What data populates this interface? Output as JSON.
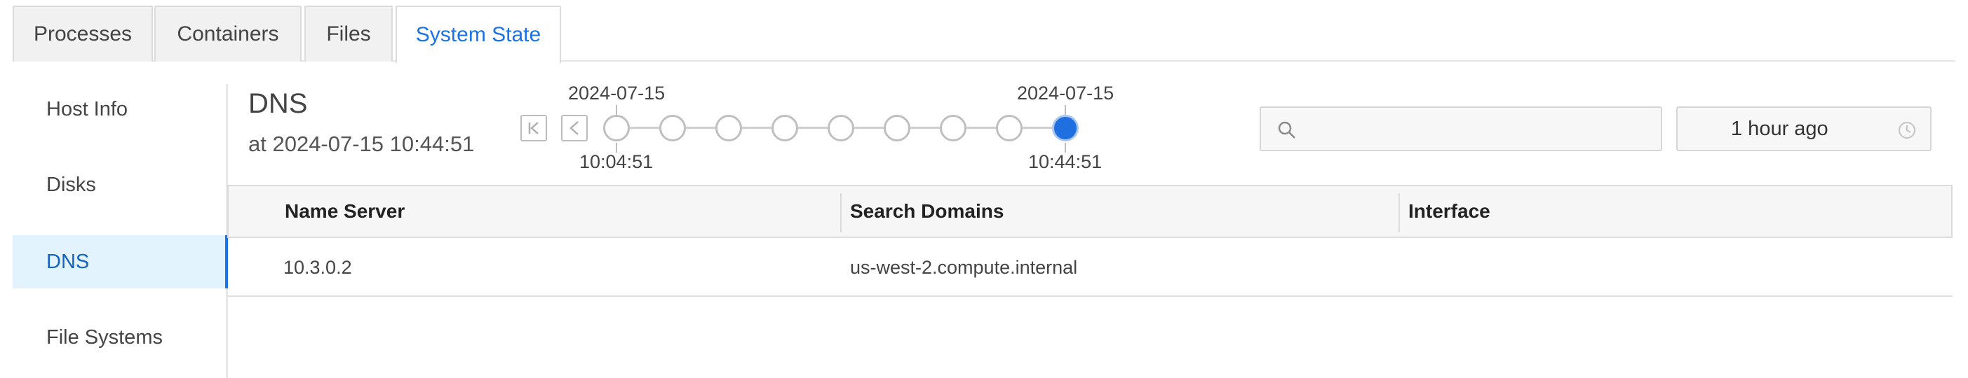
{
  "tabs": [
    {
      "label": "Processes",
      "active": false
    },
    {
      "label": "Containers",
      "active": false
    },
    {
      "label": "Files",
      "active": false
    },
    {
      "label": "System State",
      "active": true
    }
  ],
  "sidebar": {
    "items": [
      {
        "label": "Host Info",
        "active": false
      },
      {
        "label": "Disks",
        "active": false
      },
      {
        "label": "DNS",
        "active": true
      },
      {
        "label": "File Systems",
        "active": false
      }
    ]
  },
  "header": {
    "title": "DNS",
    "subtitle": "at 2024-07-15 10:44:51"
  },
  "timeline": {
    "start_date": "2024-07-15",
    "start_time": "10:04:51",
    "end_date": "2024-07-15",
    "end_time": "10:44:51",
    "point_count": 9,
    "selected_index": 8
  },
  "search": {
    "placeholder": "",
    "value": ""
  },
  "time_range": {
    "value": "1 hour ago"
  },
  "table": {
    "columns": [
      "Name Server",
      "Search Domains",
      "Interface"
    ],
    "rows": [
      [
        "10.3.0.2",
        "us-west-2.compute.internal",
        ""
      ]
    ]
  },
  "colors": {
    "accent": "#1a73e8",
    "active_sidebar_bg": "#e3f3fd",
    "timeline_active": "#1f6fe0"
  }
}
